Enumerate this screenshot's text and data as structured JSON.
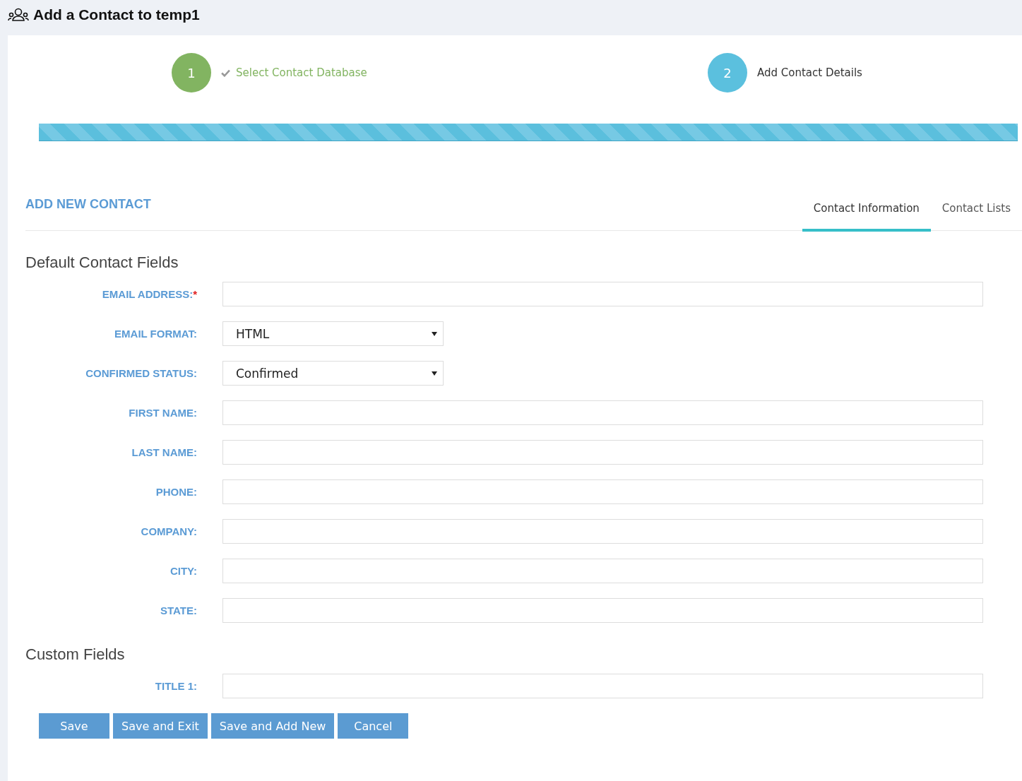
{
  "page_title": "Add a Contact to temp1",
  "steps": [
    {
      "number": "1",
      "label": "Select Contact Database",
      "completed": true
    },
    {
      "number": "2",
      "label": "Add Contact Details",
      "completed": false
    }
  ],
  "progress": {
    "level": 1
  },
  "section_title": "ADD NEW CONTACT",
  "tabs": [
    {
      "label": "Contact Information",
      "selected": true
    },
    {
      "label": "Contact Lists",
      "selected": false
    }
  ],
  "groups": [
    {
      "title": "Default Contact Fields",
      "fields": [
        {
          "label": "EMAIL ADDRESS:",
          "required_mark": "*",
          "kind": "text"
        },
        {
          "label": "EMAIL FORMAT:",
          "kind": "select",
          "value": "HTML"
        },
        {
          "label": "CONFIRMED STATUS:",
          "kind": "select",
          "value": "Confirmed"
        },
        {
          "label": "FIRST NAME:",
          "kind": "text"
        },
        {
          "label": "LAST NAME:",
          "kind": "text"
        },
        {
          "label": "PHONE:",
          "kind": "text"
        },
        {
          "label": "COMPANY:",
          "kind": "text"
        },
        {
          "label": "CITY:",
          "kind": "text"
        },
        {
          "label": "STATE:",
          "kind": "text"
        }
      ]
    },
    {
      "title": "Custom Fields",
      "fields": [
        {
          "label": "TITLE 1:",
          "kind": "text"
        }
      ]
    }
  ],
  "buttons": [
    "Save",
    "Save and Exit",
    "Save and Add New",
    "Cancel"
  ]
}
